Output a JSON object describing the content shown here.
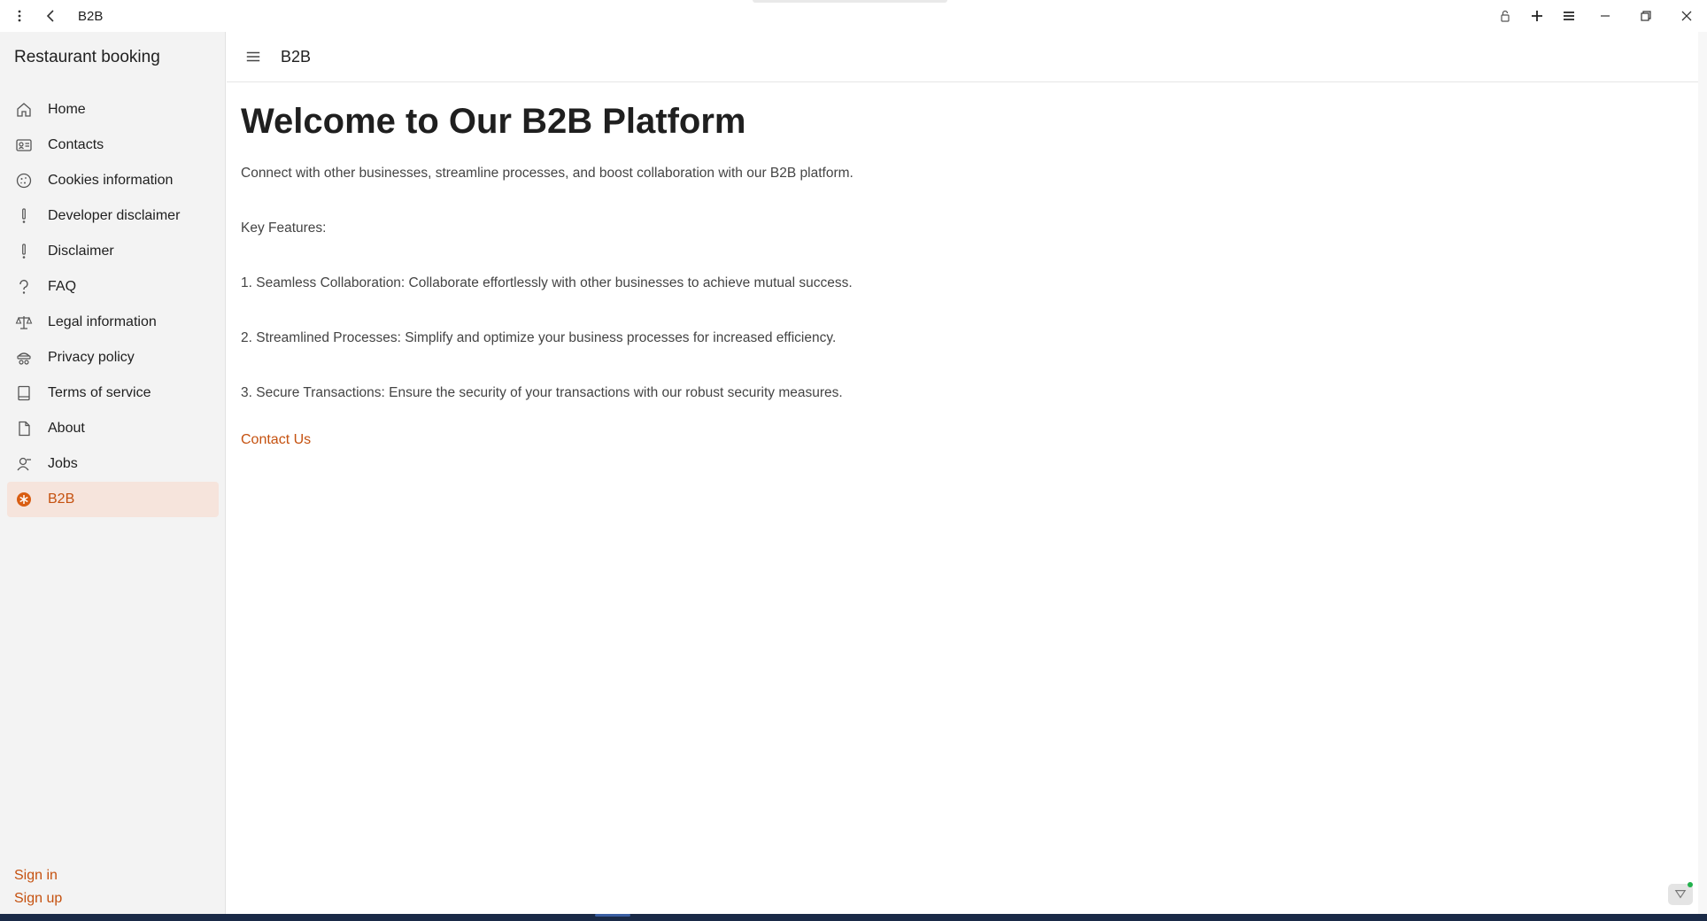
{
  "titlebar": {
    "title": "B2B",
    "icons": {
      "menu": "more-vertical-icon",
      "back": "back-arrow-icon",
      "lock": "lock-icon",
      "new": "plus-icon",
      "list": "hamburger-icon",
      "minimize": "minimize-icon",
      "restore": "restore-icon",
      "close": "close-icon"
    }
  },
  "sidebar": {
    "app_name": "Restaurant booking",
    "items": [
      {
        "label": "Home",
        "icon": "home-icon"
      },
      {
        "label": "Contacts",
        "icon": "contact-card-icon"
      },
      {
        "label": "Cookies information",
        "icon": "cookie-icon"
      },
      {
        "label": "Developer disclaimer",
        "icon": "exclamation-icon"
      },
      {
        "label": "Disclaimer",
        "icon": "exclamation-icon"
      },
      {
        "label": "FAQ",
        "icon": "question-icon"
      },
      {
        "label": "Legal information",
        "icon": "scales-icon"
      },
      {
        "label": "Privacy policy",
        "icon": "privacy-icon"
      },
      {
        "label": "Terms of service",
        "icon": "document-icon"
      },
      {
        "label": "About",
        "icon": "page-icon"
      },
      {
        "label": "Jobs",
        "icon": "person-icon"
      },
      {
        "label": "B2B",
        "icon": "b2b-icon",
        "active": true
      }
    ],
    "sign_in": "Sign in",
    "sign_up": "Sign up"
  },
  "header": {
    "title": "B2B"
  },
  "main": {
    "headline": "Welcome to Our B2B Platform",
    "intro": "Connect with other businesses, streamline processes, and boost collaboration with our B2B platform.",
    "key_features": "Key Features:",
    "feature_1": "1. Seamless Collaboration: Collaborate effortlessly with other businesses to achieve mutual success.",
    "feature_2": "2. Streamlined Processes: Simplify and optimize your business processes for increased efficiency.",
    "feature_3": "3. Secure Transactions: Ensure the security of your transactions with our robust security measures.",
    "contact_link": "Contact Us"
  },
  "colors": {
    "accent": "#c5510f",
    "active_bg": "#f6e4dc",
    "sidebar_bg": "#f3f3f3"
  }
}
